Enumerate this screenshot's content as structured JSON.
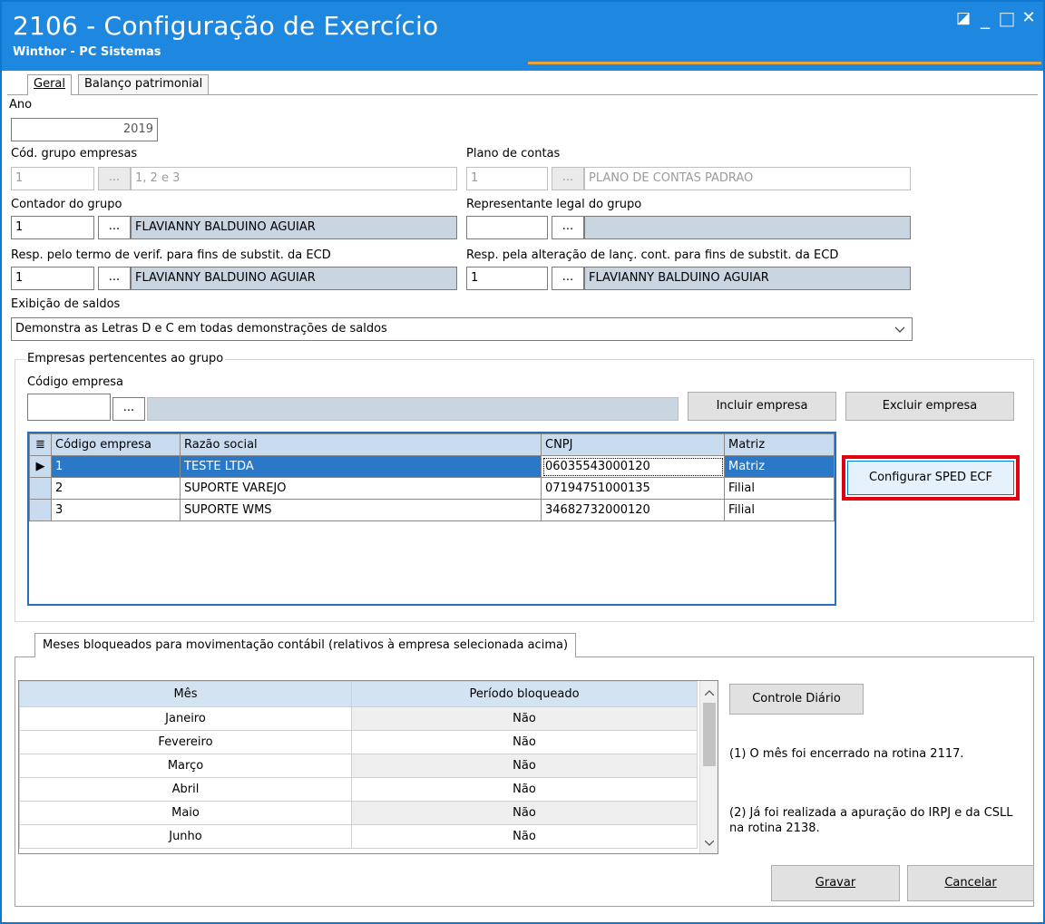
{
  "window": {
    "title": "2106 - Configuração de Exercício",
    "subtitle": "Winthor - PC Sistemas",
    "controls": {
      "restore": "◪",
      "minimize": "_",
      "maximize": "□",
      "close": "✕"
    }
  },
  "tabs": [
    {
      "label": "Geral"
    },
    {
      "label": "Balanço patrimonial"
    }
  ],
  "fields": {
    "ano": {
      "label": "Ano",
      "value": "2019"
    },
    "grupo_empresas": {
      "label": "Cód. grupo empresas",
      "code": "1",
      "desc": "1, 2 e 3"
    },
    "plano_contas": {
      "label": "Plano de contas",
      "code": "1",
      "desc": "PLANO DE CONTAS PADRAO"
    },
    "contador": {
      "label": "Contador do grupo",
      "code": "1",
      "desc": "FLAVIANNY BALDUINO AGUIAR"
    },
    "representante": {
      "label": "Representante legal do grupo",
      "code": "",
      "desc": ""
    },
    "resp_termo": {
      "label": "Resp. pelo termo de verif. para fins de substit. da ECD",
      "code": "1",
      "desc": "FLAVIANNY BALDUINO AGUIAR"
    },
    "resp_alteracao": {
      "label": "Resp. pela alteração de lanç. cont. para fins de substit. da ECD",
      "code": "1",
      "desc": "FLAVIANNY BALDUINO AGUIAR"
    },
    "exibicao": {
      "label": "Exibição de saldos",
      "value": "Demonstra as Letras D e C em todas demonstrações de saldos"
    },
    "dots_label": "..."
  },
  "empresas": {
    "group_title": "Empresas pertencentes ao grupo",
    "codigo_label": "Código empresa",
    "incluir": "Incluir empresa",
    "excluir": "Excluir empresa",
    "configurar": "Configurar SPED ECF",
    "columns": [
      "Código empresa",
      "Razão social",
      "CNPJ",
      "Matriz"
    ],
    "rows": [
      {
        "codigo": "1",
        "razao": "TESTE  LTDA",
        "cnpj": "06035543000120",
        "matriz": "Matriz"
      },
      {
        "codigo": "2",
        "razao": "SUPORTE VAREJO",
        "cnpj": "07194751000135",
        "matriz": "Filial"
      },
      {
        "codigo": "3",
        "razao": "SUPORTE WMS",
        "cnpj": "34682732000120",
        "matriz": "Filial"
      }
    ]
  },
  "meses": {
    "tab_label": "Meses bloqueados para movimentação contábil (relativos à empresa selecionada acima)",
    "columns": [
      "Mês",
      "Período bloqueado"
    ],
    "rows": [
      {
        "mes": "Janeiro",
        "bloqueado": "Não"
      },
      {
        "mes": "Fevereiro",
        "bloqueado": "Não"
      },
      {
        "mes": "Março",
        "bloqueado": "Não"
      },
      {
        "mes": "Abril",
        "bloqueado": "Não"
      },
      {
        "mes": "Maio",
        "bloqueado": "Não"
      },
      {
        "mes": "Junho",
        "bloqueado": "Não"
      }
    ],
    "controle_diario": "Controle Diário",
    "note1": "(1)  O mês foi encerrado na rotina 2117.",
    "note2": "(2)  Já foi realizada a apuração do IRPJ e da CSLL na rotina 2138."
  },
  "footer": {
    "gravar": "Gravar",
    "cancelar": "Cancelar"
  },
  "colors": {
    "titlebar": "#1e87df",
    "selection": "#2a78c8",
    "highlight_border": "#e0000f"
  }
}
